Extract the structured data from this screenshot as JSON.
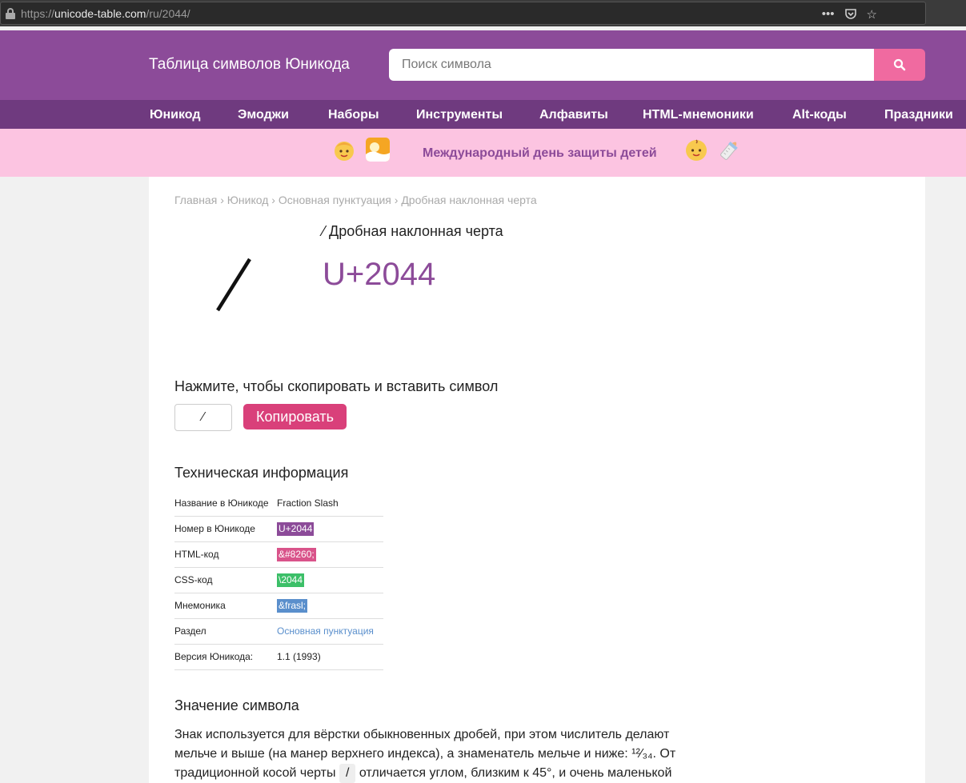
{
  "browser": {
    "url_scheme": "https://",
    "url_host": "unicode-table.com",
    "url_path": "/ru/2044/"
  },
  "header": {
    "title": "Таблица символов Юникода",
    "search_placeholder": "Поиск символа"
  },
  "nav": {
    "items": [
      "Юникод",
      "Эмоджи",
      "Наборы",
      "Инструменты",
      "Алфавиты",
      "HTML-мнемоники",
      "Alt-коды",
      "Праздники"
    ]
  },
  "banner": {
    "text": "Международный день защиты детей"
  },
  "breadcrumb": [
    "Главная",
    "Юникод",
    "Основная пунктуация",
    "Дробная наклонная черта"
  ],
  "breadcrumb_sep": "›",
  "symbol": {
    "glyph": "⁄",
    "name": "Дробная наклонная черта",
    "codepoint": "U+2044"
  },
  "copy": {
    "label": "Нажмите, чтобы скопировать и вставить символ",
    "value": "⁄",
    "button": "Копировать"
  },
  "tech": {
    "heading": "Техническая информация",
    "rows": [
      {
        "key": "Название в Юникоде",
        "value": "Fraction Slash"
      },
      {
        "key": "Номер в Юникоде",
        "value": "U+2044"
      },
      {
        "key": "HTML-код",
        "value": "&#8260;"
      },
      {
        "key": "CSS-код",
        "value": "\\2044"
      },
      {
        "key": "Мнемоника",
        "value": "&frasl;"
      },
      {
        "key": "Раздел",
        "value": "Основная пунктуация"
      },
      {
        "key": "Версия Юникода:",
        "value": "1.1 (1993)"
      }
    ]
  },
  "meaning": {
    "heading": "Значение символа",
    "text_before": "Знак используется для вёрстки обыкновенных дробей, при этом числитель делают мельче и выше (на манер верхнего индекса), а знаменатель мельче и ниже: ¹²⁄₃₄. От традиционной косой черты",
    "chip": "/",
    "text_after": "отличается углом, близким к 45°, и очень маленькой"
  },
  "colors": {
    "brand": "#8c4b99",
    "nav": "#6f3a7f",
    "accent": "#f06aa0",
    "copy_button": "#d9407a",
    "banner": "#fcc4e1"
  }
}
